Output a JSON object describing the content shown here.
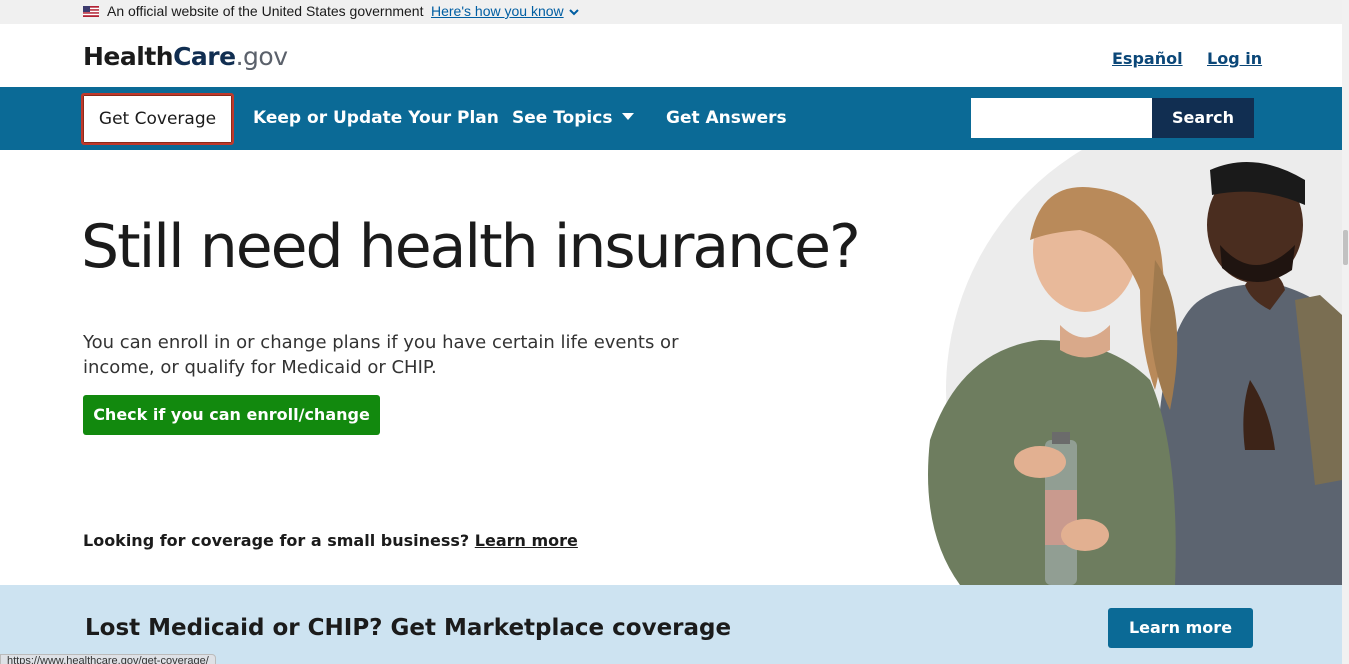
{
  "gov_banner": {
    "official_text": "An official website of the United States government",
    "how_link": "Here's how you know"
  },
  "header": {
    "logo_health": "Health",
    "logo_care": "Care",
    "logo_gov": ".gov",
    "lang_link": "Español",
    "login_link": "Log in"
  },
  "nav": {
    "items": [
      {
        "label": "Get Coverage"
      },
      {
        "label": "Keep or Update Your Plan"
      },
      {
        "label": "See Topics"
      },
      {
        "label": "Get Answers"
      }
    ],
    "search_placeholder": "",
    "search_button": "Search"
  },
  "hero": {
    "title": "Still need health insurance?",
    "body": "You can enroll in or change plans if you have certain life events or income, or qualify for Medicaid or CHIP.",
    "cta": "Check if you can enroll/change",
    "small_biz_text": "Looking for coverage for a small business?",
    "small_biz_link": "Learn more"
  },
  "promo": {
    "title": "Lost Medicaid or CHIP? Get Marketplace coverage",
    "button": "Learn more"
  },
  "status_bar": {
    "url": "https://www.healthcare.gov/get-coverage/"
  },
  "colors": {
    "nav_bg": "#0b6a96",
    "search_btn": "#112e51",
    "cta_green": "#12890e",
    "promo_bg": "#cde3f1"
  }
}
